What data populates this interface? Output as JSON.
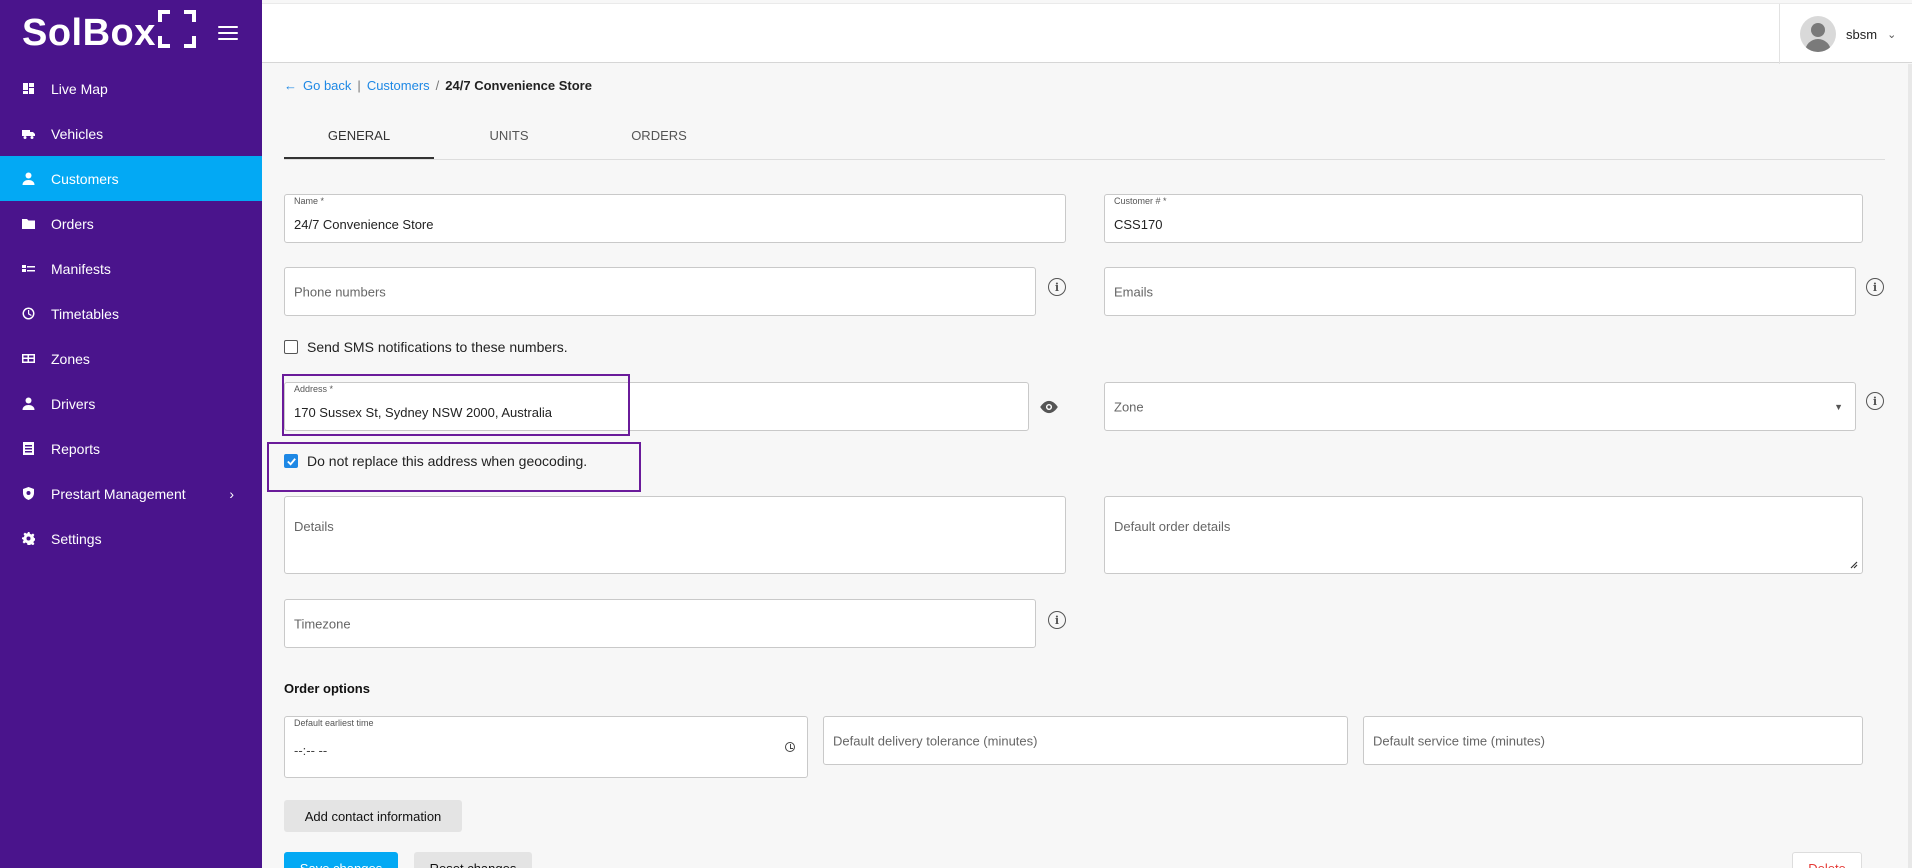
{
  "brand": {
    "name": "SolBox"
  },
  "sidebar": {
    "items": [
      {
        "label": "Live Map",
        "icon": "dashboard-icon",
        "active": false
      },
      {
        "label": "Vehicles",
        "icon": "truck-icon",
        "active": false
      },
      {
        "label": "Customers",
        "icon": "person-icon",
        "active": true
      },
      {
        "label": "Orders",
        "icon": "folder-icon",
        "active": false
      },
      {
        "label": "Manifests",
        "icon": "list-icon",
        "active": false
      },
      {
        "label": "Timetables",
        "icon": "clock-icon",
        "active": false
      },
      {
        "label": "Zones",
        "icon": "zones-icon",
        "active": false
      },
      {
        "label": "Drivers",
        "icon": "person-icon",
        "active": false
      },
      {
        "label": "Reports",
        "icon": "report-icon",
        "active": false
      },
      {
        "label": "Prestart Management",
        "icon": "shield-icon",
        "active": false,
        "has_submenu": true
      },
      {
        "label": "Settings",
        "icon": "gear-icon",
        "active": false
      }
    ]
  },
  "header": {
    "username": "sbsm"
  },
  "breadcrumb": {
    "back": "Go back",
    "sep1": "|",
    "parent": "Customers",
    "sep2": "/",
    "current": "24/7 Convenience Store"
  },
  "tabs": [
    {
      "label": "GENERAL",
      "active": true
    },
    {
      "label": "UNITS",
      "active": false
    },
    {
      "label": "ORDERS",
      "active": false
    }
  ],
  "form": {
    "name": {
      "label": "Name *",
      "value": "24/7 Convenience Store"
    },
    "customer_no": {
      "label": "Customer # *",
      "value": "CSS170"
    },
    "phone": {
      "placeholder": "Phone numbers"
    },
    "emails": {
      "placeholder": "Emails"
    },
    "sms_notify": {
      "label": "Send SMS notifications to these numbers.",
      "checked": false
    },
    "address": {
      "label": "Address *",
      "value": "170 Sussex St, Sydney NSW 2000, Australia"
    },
    "zone": {
      "placeholder": "Zone"
    },
    "no_replace": {
      "label": "Do not replace this address when geocoding.",
      "checked": true
    },
    "details": {
      "placeholder": "Details"
    },
    "default_order_details": {
      "placeholder": "Default order details"
    },
    "timezone": {
      "placeholder": "Timezone"
    }
  },
  "order_options": {
    "title": "Order options",
    "earliest": {
      "label": "Default earliest time",
      "value": "--:-- --"
    },
    "tolerance": {
      "placeholder": "Default delivery tolerance (minutes)"
    },
    "service_time": {
      "placeholder": "Default service time (minutes)"
    }
  },
  "buttons": {
    "add_contact": "Add contact information",
    "save": "Save changes",
    "reset": "Reset changes",
    "delete": "Delete"
  },
  "colors": {
    "sidebar": "#4a148c",
    "active": "#03a9f4",
    "highlight": "#6a1b9a",
    "link": "#1e88e5"
  }
}
